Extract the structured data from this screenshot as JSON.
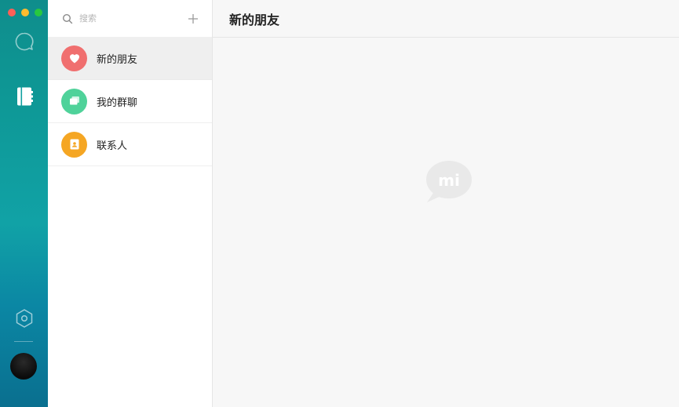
{
  "search": {
    "placeholder": "搜索"
  },
  "contacts_menu": {
    "items": [
      {
        "label": "新的朋友",
        "icon": "heart-icon",
        "color": "#f06f6f"
      },
      {
        "label": "我的群聊",
        "icon": "group-chat-icon",
        "color": "#4fd29a"
      },
      {
        "label": "联系人",
        "icon": "contact-card-icon",
        "color": "#f5a623"
      }
    ],
    "selected_index": 0
  },
  "main": {
    "title": "新的朋友",
    "empty_logo_text": "mi"
  },
  "colors": {
    "rail_accent": "#0f9a99",
    "list_bg": "#ffffff",
    "main_bg": "#f7f7f7"
  }
}
